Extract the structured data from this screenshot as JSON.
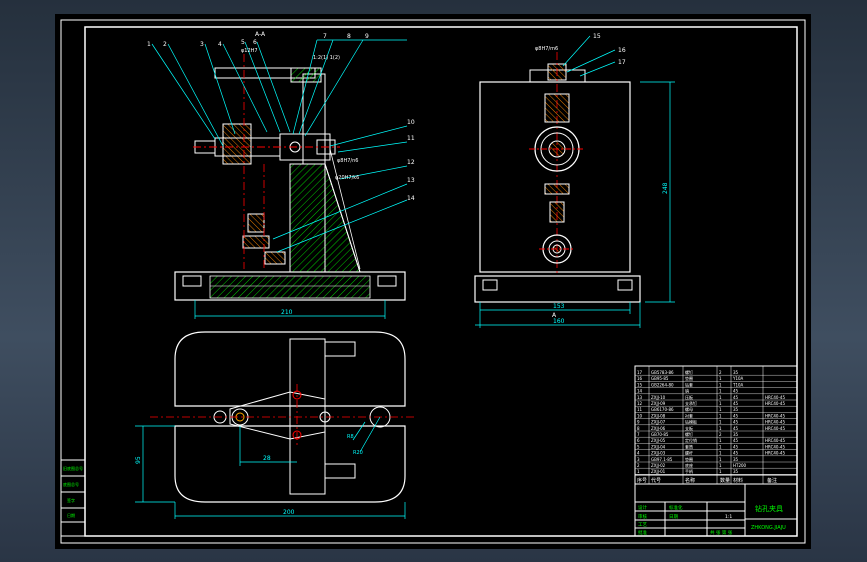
{
  "colors": {
    "background": "#000000",
    "outline": "#ffffff",
    "dimension": "#00ffff",
    "hatch": "#00ff00",
    "centerline": "#ff0000",
    "leader": "#00ffff",
    "callout_text": "#ffffff",
    "title_text": "#00ff00"
  },
  "front_view": {
    "section_label": "A-A",
    "base_width_dim": "210",
    "part_callouts": [
      "1",
      "2",
      "3",
      "4",
      "5",
      "6",
      "7",
      "8",
      "9",
      "10",
      "11",
      "12",
      "13",
      "14"
    ],
    "fit_notes": [
      "φ8H7/n6",
      "φ20H7/k6",
      "φ12H7"
    ],
    "note": "1:2(1) 1(2)"
  },
  "side_view": {
    "part_callouts": [
      "15",
      "16",
      "17"
    ],
    "fit_note": "φ8H7/m6",
    "height_dim": "248",
    "inner_width_dim": "153",
    "outer_width_dim": "160",
    "section_marker": "A"
  },
  "top_view": {
    "width_dim": "200",
    "height_dim": "95",
    "offset_dim": "28",
    "radius_dims": [
      "R8",
      "R20"
    ]
  },
  "parts_list": {
    "rows": [
      [
        "17",
        "GB5783-86",
        "螺钉",
        "2",
        "35",
        ""
      ],
      [
        "16",
        "GB95-85",
        "垫圈",
        "1",
        "Y10A",
        ""
      ],
      [
        "15",
        "GB2264-80",
        "钻套",
        "1",
        "T10A",
        ""
      ],
      [
        "14",
        "",
        "销",
        "1",
        "45",
        ""
      ],
      [
        "13",
        "ZXJJ-10",
        "压板",
        "1",
        "45",
        "HRC40-45"
      ],
      [
        "12",
        "ZXJJ-09",
        "支承钉",
        "1",
        "45",
        "HRC40-45"
      ],
      [
        "11",
        "GB6170-86",
        "螺母",
        "1",
        "35",
        ""
      ],
      [
        "10",
        "ZXJJ-08",
        "衬套",
        "1",
        "45",
        "HRC40-45"
      ],
      [
        "9",
        "ZXJJ-07",
        "钻模板",
        "1",
        "45",
        "HRC40-45"
      ],
      [
        "8",
        "ZXJJ-06",
        "支板",
        "1",
        "45",
        "HRC40-45"
      ],
      [
        "7",
        "GB70-85",
        "螺钉",
        "2",
        "35",
        ""
      ],
      [
        "6",
        "ZXJJ-05",
        "定位销",
        "1",
        "45",
        "HRC40-45"
      ],
      [
        "5",
        "ZXJJ-04",
        "套筒",
        "1",
        "45",
        "HRC40-45"
      ],
      [
        "4",
        "ZXJJ-03",
        "螺杆",
        "1",
        "45",
        "HRC40-45"
      ],
      [
        "3",
        "GB97.1-85",
        "垫圈",
        "1",
        "35",
        ""
      ],
      [
        "2",
        "ZXJJ-02",
        "底座",
        "1",
        "HT200",
        ""
      ],
      [
        "1",
        "ZXJJ-01",
        "手柄",
        "1",
        "35",
        ""
      ]
    ],
    "headers": [
      "序号",
      "代号",
      "名称",
      "数量",
      "材料",
      "备注"
    ]
  },
  "title_block": {
    "drawing_name": "钻孔夹具",
    "drawing_code": "ZHKONG.JIAJU",
    "scale": "1:1",
    "sheet": "共 张 第 张",
    "cells": [
      "设计",
      "审核",
      "工艺",
      "批准",
      "标准化",
      "日期"
    ]
  },
  "left_side_table": {
    "labels": [
      "旧底图总号",
      "底图总号",
      "签字",
      "日期"
    ]
  }
}
